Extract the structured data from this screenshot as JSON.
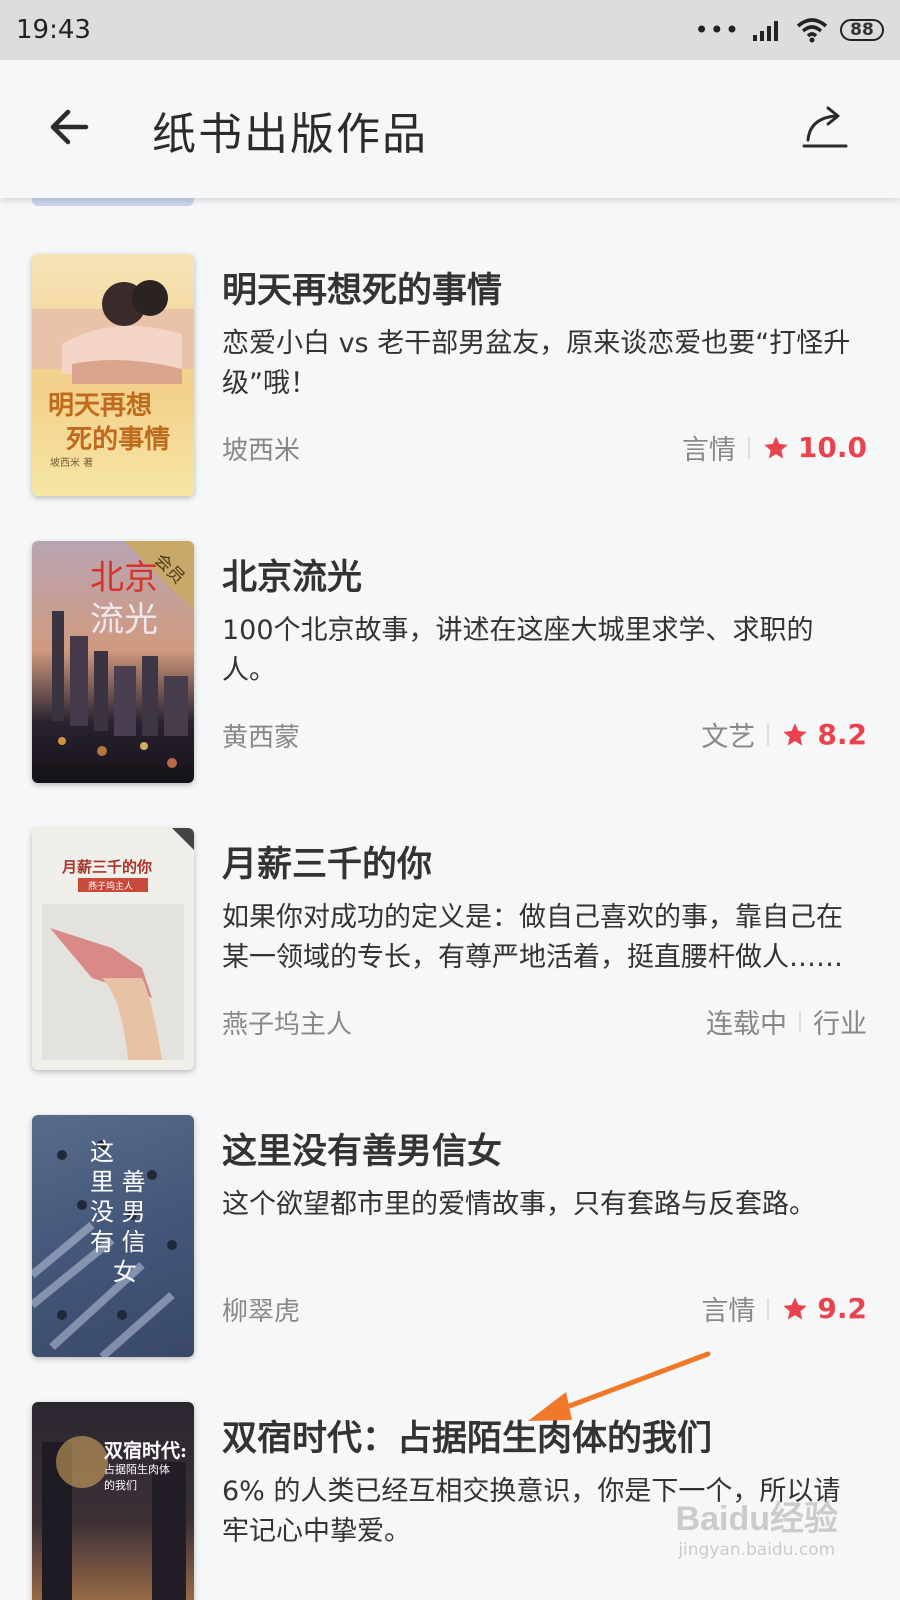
{
  "status_bar": {
    "time": "19:43",
    "battery": "88"
  },
  "app_bar": {
    "title": "纸书出版作品"
  },
  "books": [
    {
      "title": "明天再想死的事情",
      "desc": "恋爱小白 vs 老干部男盆友，原来谈恋爱也要“打怪升级”哦！",
      "author": "坡西米",
      "genre": "言情",
      "rating": "10.0",
      "cover_title": "明天再想死的事情"
    },
    {
      "title": "北京流光",
      "desc": "100个北京故事，讲述在这座大城里求学、求职的人。",
      "author": "黄西蒙",
      "genre": "文艺",
      "rating": "8.2",
      "cover_title": "北京流光",
      "cover_badge": "会员"
    },
    {
      "title": "月薪三千的你",
      "desc": "如果你对成功的定义是：做自己喜欢的事，靠自己在某一领域的专长，有尊严地活着，挺直腰杆做人……",
      "author": "燕子坞主人",
      "status": "连载中",
      "genre": "行业",
      "cover_title": "月薪三千的你",
      "cover_subtitle": "燕子坞主人"
    },
    {
      "title": "这里没有善男信女",
      "desc": "这个欲望都市里的爱情故事，只有套路与反套路。",
      "author": "柳翠虎",
      "genre": "言情",
      "rating": "9.2",
      "cover_title": "这里没有善男信女"
    },
    {
      "title": "双宿时代：占据陌生肉体的我们",
      "desc": "6% 的人类已经互相交换意识，你是下一个，所以请牢记心中挚爱。",
      "cover_title": "双宿时代:",
      "cover_subtitle": "占据陌生肉体的我们"
    }
  ],
  "watermark": {
    "main": "Baidu经验",
    "sub": "jingyan.baidu.com"
  },
  "colors": {
    "accent": "#e8434e",
    "arrow": "#f07828"
  }
}
